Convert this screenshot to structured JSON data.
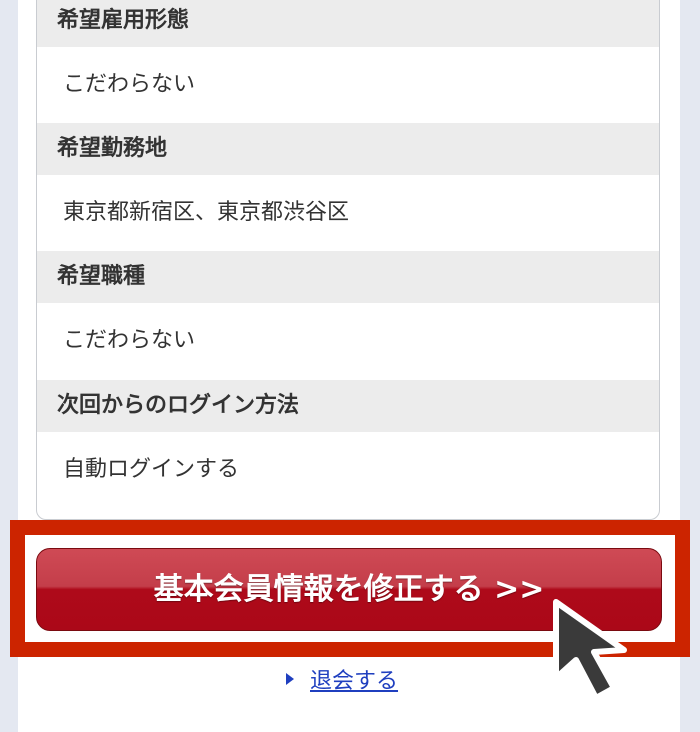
{
  "profile": {
    "rows": [
      {
        "label": "希望雇用形態",
        "value": "こだわらない"
      },
      {
        "label": "希望勤務地",
        "value": "東京都新宿区、東京都渋谷区"
      },
      {
        "label": "希望職種",
        "value": "こだわらない"
      },
      {
        "label": "次回からのログイン方法",
        "value": "自動ログインする"
      }
    ]
  },
  "actions": {
    "edit_button_label": "基本会員情報を修正する >>",
    "withdraw_link_label": "退会する"
  },
  "colors": {
    "highlight_border": "#cc2400",
    "button_red": "#ae0a1a",
    "link_blue": "#1f3fbf",
    "label_bg": "#ececec"
  },
  "icons": {
    "withdraw_marker": "triangle-right-icon",
    "pointer": "mouse-pointer-icon"
  }
}
